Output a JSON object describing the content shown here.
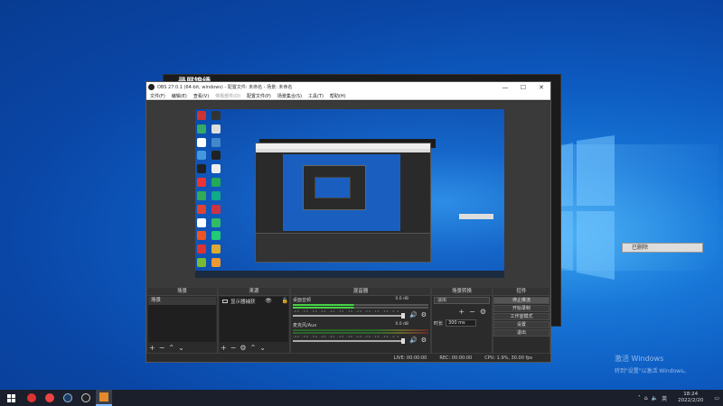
{
  "desktop": {
    "activate_title": "激活 Windows",
    "activate_sub": "转到\"设置\"以激活 Windows。",
    "tooltip_text": "已删除"
  },
  "back_window": {
    "title": "录屏锦绣"
  },
  "obs": {
    "title": "OBS 27.0.1 (64-bit, windows) - 配置文件: 未命名 - 场景: 未命名",
    "menu": [
      "文件(F)",
      "编辑(E)",
      "查看(V)",
      "停靠部件(D)",
      "配置文件(P)",
      "场景集合(S)",
      "工具(T)",
      "帮助(H)"
    ],
    "window_controls": {
      "minimize": "—",
      "maximize": "☐",
      "close": "✕"
    },
    "docks": {
      "scenes": {
        "title": "场景",
        "items": [
          "场景"
        ]
      },
      "sources": {
        "title": "来源",
        "items": [
          {
            "name": "显示器捕获"
          }
        ]
      },
      "mixer": {
        "title": "混音器",
        "channels": [
          {
            "name": "桌面音频",
            "db": "0.0 dB",
            "tick_scale": "-60 -55 -50 -45 -40 -35 -30 -25 -20 -15 -10 -5 0"
          },
          {
            "name": "麦克风/Aux",
            "db": "0.0 dB",
            "tick_scale": "-60 -55 -50 -45 -40 -35 -30 -25 -20 -15 -10 -5 0"
          }
        ]
      },
      "transitions": {
        "title": "场景转换",
        "selected": "淡出",
        "duration_label": "时长",
        "duration_value": "300 ms"
      },
      "controls": {
        "title": "控件",
        "buttons": [
          "停止推流",
          "开始录制",
          "工作室模式",
          "设置",
          "退出"
        ]
      }
    },
    "status": {
      "live": "LIVE: 00:00:00",
      "rec": "REC: 00:00:00",
      "cpu": "CPU: 1.9%, 30.00 fps"
    }
  },
  "taskbar": {
    "clock_time": "18:24",
    "clock_date": "2022/2/20",
    "tray_lang": "英"
  },
  "colors": {
    "desktop_blue": "#0d5bc1",
    "obs_bg": "#2b2b2b",
    "taskbar_bg": "#1a1f2b"
  }
}
